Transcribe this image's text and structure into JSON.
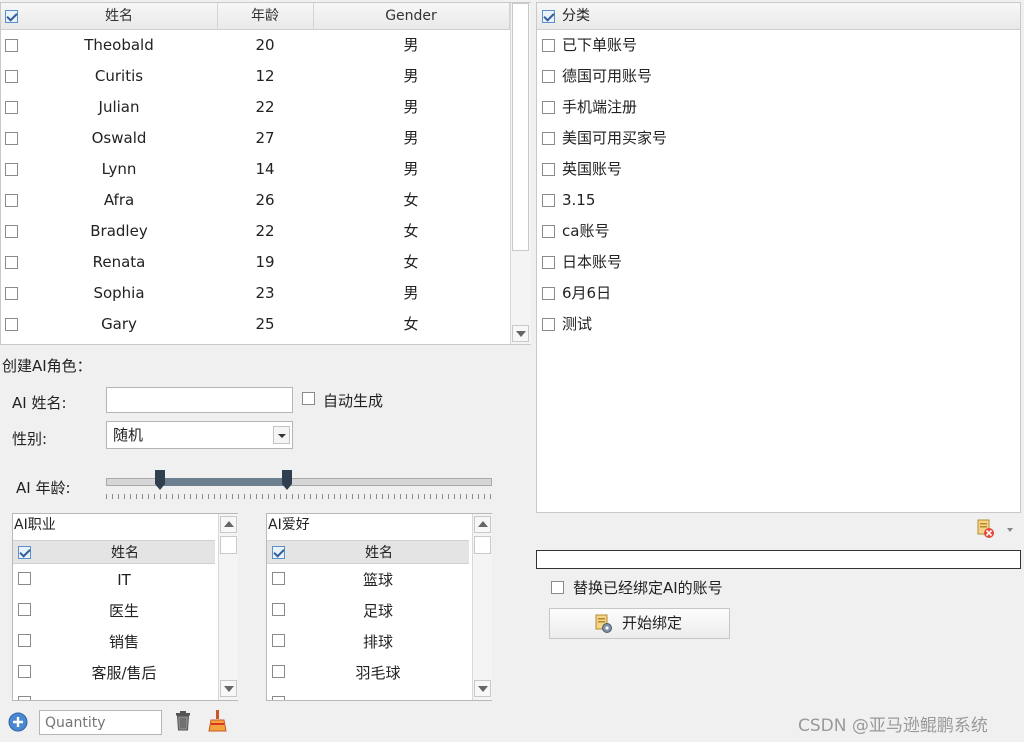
{
  "main_table": {
    "columns": [
      "姓名",
      "年龄",
      "Gender"
    ],
    "rows": [
      {
        "name": "Theobald",
        "age": "20",
        "gender": "男"
      },
      {
        "name": "Curitis",
        "age": "12",
        "gender": "男"
      },
      {
        "name": "Julian",
        "age": "22",
        "gender": "男"
      },
      {
        "name": "Oswald",
        "age": "27",
        "gender": "男"
      },
      {
        "name": "Lynn",
        "age": "14",
        "gender": "男"
      },
      {
        "name": "Afra",
        "age": "26",
        "gender": "女"
      },
      {
        "name": "Bradley",
        "age": "22",
        "gender": "女"
      },
      {
        "name": "Renata",
        "age": "19",
        "gender": "女"
      },
      {
        "name": "Sophia",
        "age": "23",
        "gender": "男"
      },
      {
        "name": "Gary",
        "age": "25",
        "gender": "女"
      }
    ]
  },
  "category_list": {
    "header": "分类",
    "items": [
      "已下单账号",
      "德国可用账号",
      "手机端注册",
      "美国可用买家号",
      "英国账号",
      "3.15",
      "ca账号",
      "日本账号",
      "6月6日",
      "测试"
    ]
  },
  "create_ai": {
    "section_title": "创建AI角色：",
    "name_label": "AI 姓名:",
    "name_value": "",
    "auto_generate_label": "自动生成",
    "gender_label": "性别:",
    "gender_value": "随机",
    "age_label": "AI 年龄:",
    "age_range_low": 0.14,
    "age_range_high": 0.47
  },
  "occupation": {
    "title": "AI职业",
    "header": "姓名",
    "items": [
      "IT",
      "医生",
      "销售",
      "客服/售后"
    ]
  },
  "hobby": {
    "title": "AI爱好",
    "header": "姓名",
    "items": [
      "篮球",
      "足球",
      "排球",
      "羽毛球"
    ]
  },
  "bottom_bar": {
    "quantity_placeholder": "Quantity"
  },
  "bind": {
    "replace_label": "替换已经绑定AI的账号",
    "start_button": "开始绑定"
  },
  "watermark": "CSDN @亚马逊鲲鹏系统"
}
